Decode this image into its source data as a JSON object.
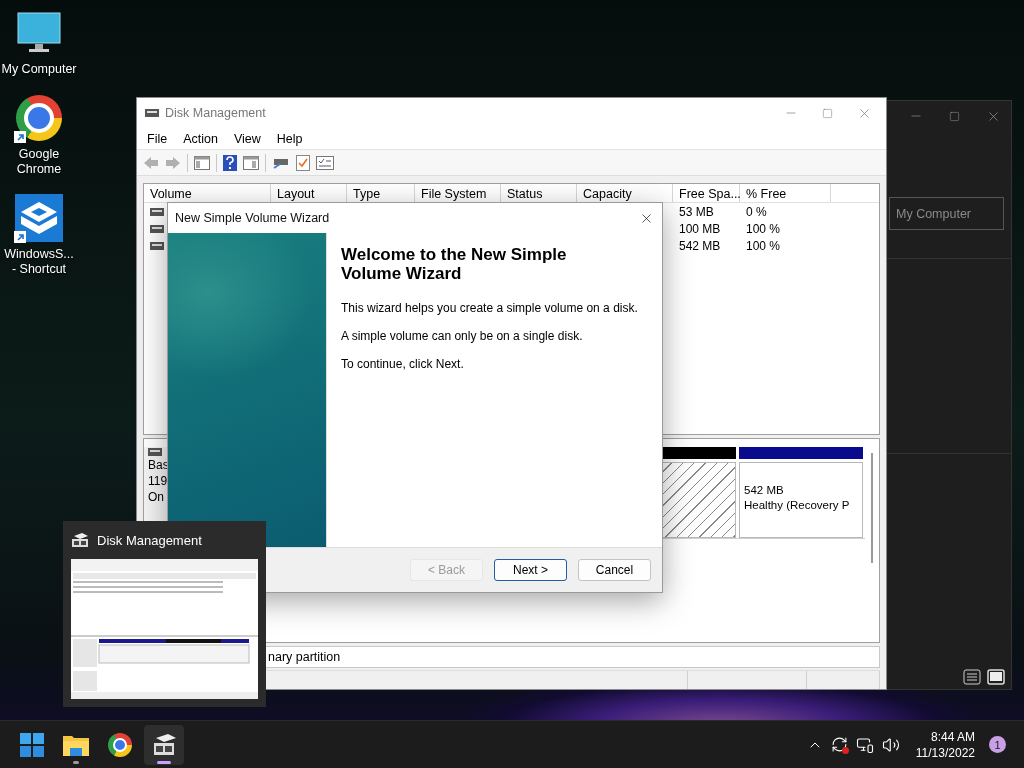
{
  "desktop_icons": [
    {
      "kind": "computer",
      "label": "My Computer",
      "shortcut": false
    },
    {
      "kind": "browser",
      "label": "Google Chrome",
      "shortcut": true
    },
    {
      "kind": "sandbox",
      "label": "WindowsS... - Shortcut",
      "shortcut": true
    }
  ],
  "back_window": {
    "placeholder": "My Computer"
  },
  "disk_management": {
    "title": "Disk Management",
    "menu": [
      "File",
      "Action",
      "View",
      "Help"
    ],
    "columns": [
      "Volume",
      "Layout",
      "Type",
      "File System",
      "Status",
      "Capacity",
      "Free Spa...",
      "% Free"
    ],
    "rows": [
      {
        "free_space": "53 MB",
        "percent_free": "0 %"
      },
      {
        "free_space": "100 MB",
        "percent_free": "100 %"
      },
      {
        "free_space": "542 MB",
        "percent_free": "100 %"
      }
    ],
    "disk": {
      "label_lines": [
        "Bas",
        "119",
        "On"
      ],
      "partitions": [
        {
          "kind": "unallocated"
        },
        {
          "kind": "primary",
          "size": "542 MB",
          "status": "Healthy (Recovery P"
        }
      ]
    },
    "legend": "nary partition"
  },
  "wizard": {
    "title": "New Simple Volume Wizard",
    "heading": "Welcome to the New Simple Volume Wizard",
    "paragraphs": [
      "This wizard helps you create a simple volume on a disk.",
      "A simple volume can only be on a single disk.",
      "To continue, click Next."
    ],
    "buttons": [
      {
        "label": "< Back",
        "disabled": true,
        "focused": false
      },
      {
        "label": "Next >",
        "disabled": false,
        "focused": true
      },
      {
        "label": "Cancel",
        "disabled": false,
        "focused": false
      }
    ]
  },
  "thumbnail": {
    "title": "Disk Management"
  },
  "taskbar": {
    "apps": [
      {
        "kind": "start",
        "running": false,
        "active": false
      },
      {
        "kind": "explorer",
        "running": true,
        "active": false
      },
      {
        "kind": "browser",
        "running": false,
        "active": false
      },
      {
        "kind": "disk",
        "running": true,
        "active": true
      }
    ],
    "time": "8:44 AM",
    "date": "11/13/2022",
    "badge": "1"
  }
}
